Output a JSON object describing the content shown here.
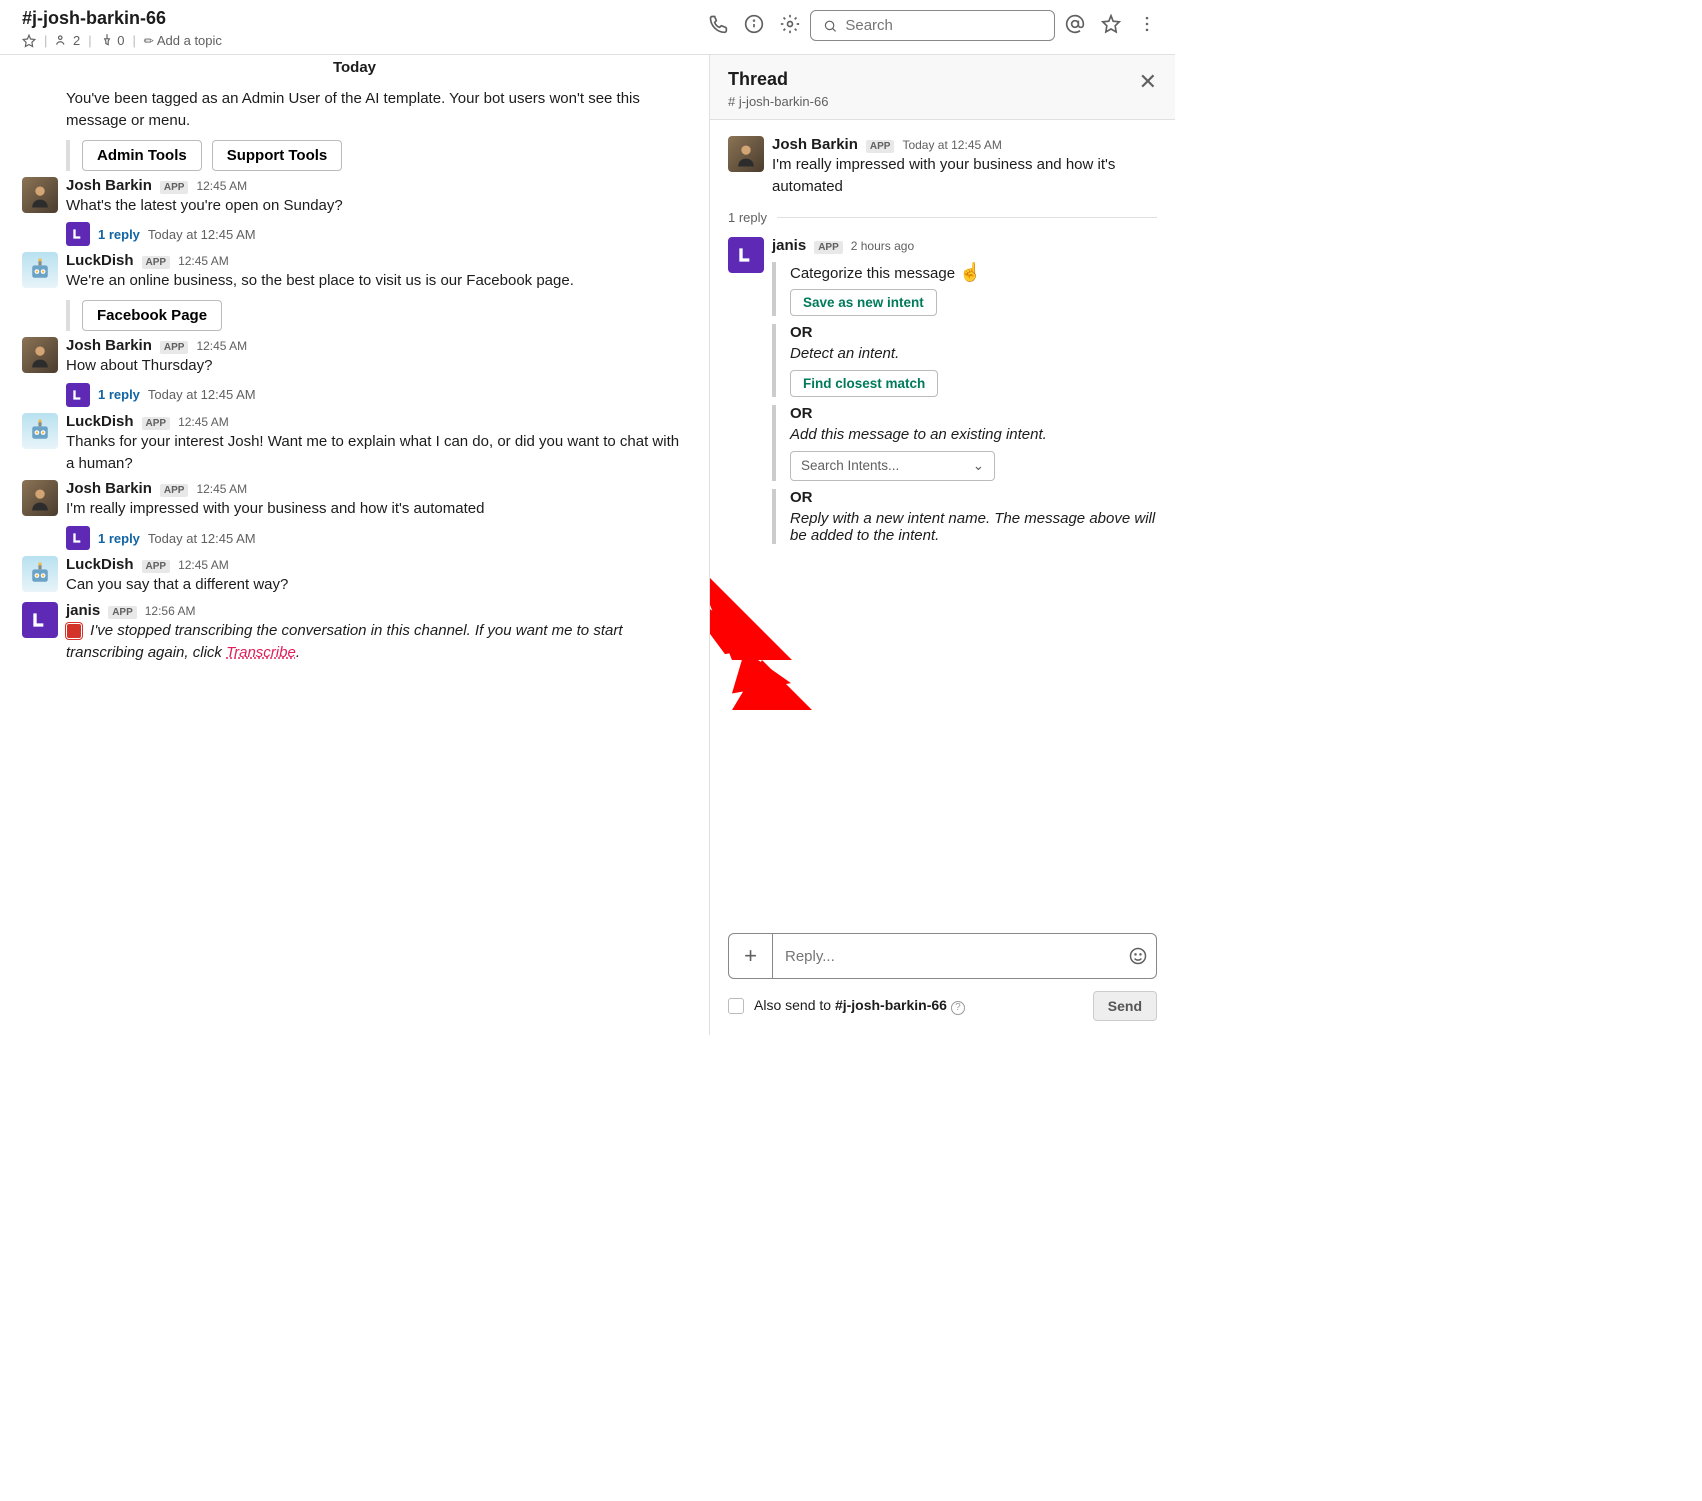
{
  "header": {
    "channel_name": "#j-josh-barkin-66",
    "member_count": "2",
    "pin_count": "0",
    "add_topic": "Add a topic",
    "search_placeholder": "Search"
  },
  "date_divider": "Today",
  "admin_msg": {
    "text": "You've been tagged as an Admin User of the AI template. Your bot users won't see this message or menu.",
    "btn1": "Admin Tools",
    "btn2": "Support Tools"
  },
  "messages": [
    {
      "author": "Josh Barkin",
      "badge": "APP",
      "time": "12:45 AM",
      "text": "What's the latest you're open on Sunday?",
      "avatar": "person",
      "reply": {
        "count": "1 reply",
        "time": "Today at 12:45 AM"
      }
    },
    {
      "author": "LuckDish",
      "badge": "APP",
      "time": "12:45 AM",
      "text": "We're an online business, so the best place to visit us is our Facebook page.",
      "avatar": "robot",
      "button": "Facebook Page"
    },
    {
      "author": "Josh Barkin",
      "badge": "APP",
      "time": "12:45 AM",
      "text": "How about Thursday?",
      "avatar": "person",
      "reply": {
        "count": "1 reply",
        "time": "Today at 12:45 AM"
      }
    },
    {
      "author": "LuckDish",
      "badge": "APP",
      "time": "12:45 AM",
      "text": "Thanks for your interest Josh! Want me to explain what I can do, or did you want to chat with a human?",
      "avatar": "robot"
    },
    {
      "author": "Josh Barkin",
      "badge": "APP",
      "time": "12:45 AM",
      "text": "I'm really impressed with your business and how it's automated",
      "avatar": "person",
      "reply": {
        "count": "1 reply",
        "time": "Today at 12:45 AM"
      }
    },
    {
      "author": "LuckDish",
      "badge": "APP",
      "time": "12:45 AM",
      "text": "Can you say that a different way?",
      "avatar": "robot"
    }
  ],
  "janis_msg": {
    "author": "janis",
    "badge": "APP",
    "time": "12:56 AM",
    "text_prefix": "I've stopped transcribing the conversation in this channel. If you want me to start transcribing again, click ",
    "transcribe": "Transcribe"
  },
  "thread": {
    "title": "Thread",
    "subtitle": "# j-josh-barkin-66",
    "root": {
      "author": "Josh Barkin",
      "badge": "APP",
      "time": "Today at 12:45 AM",
      "text": "I'm really impressed with your business and how it's automated"
    },
    "reply_count": "1 reply",
    "janis": {
      "author": "janis",
      "badge": "APP",
      "time": "2 hours ago"
    },
    "block1": {
      "title": "Categorize this message",
      "btn": "Save as new intent"
    },
    "block2": {
      "or": "OR",
      "sub": "Detect an intent.",
      "btn": "Find closest match"
    },
    "block3": {
      "or": "OR",
      "sub": "Add this message to an existing intent.",
      "select": "Search Intents..."
    },
    "block4": {
      "or": "OR",
      "sub": "Reply with a new intent name. The message above will be added to the intent."
    },
    "reply_placeholder": "Reply...",
    "also_send_prefix": "Also send to ",
    "also_send_channel": "#j-josh-barkin-66",
    "send": "Send"
  }
}
